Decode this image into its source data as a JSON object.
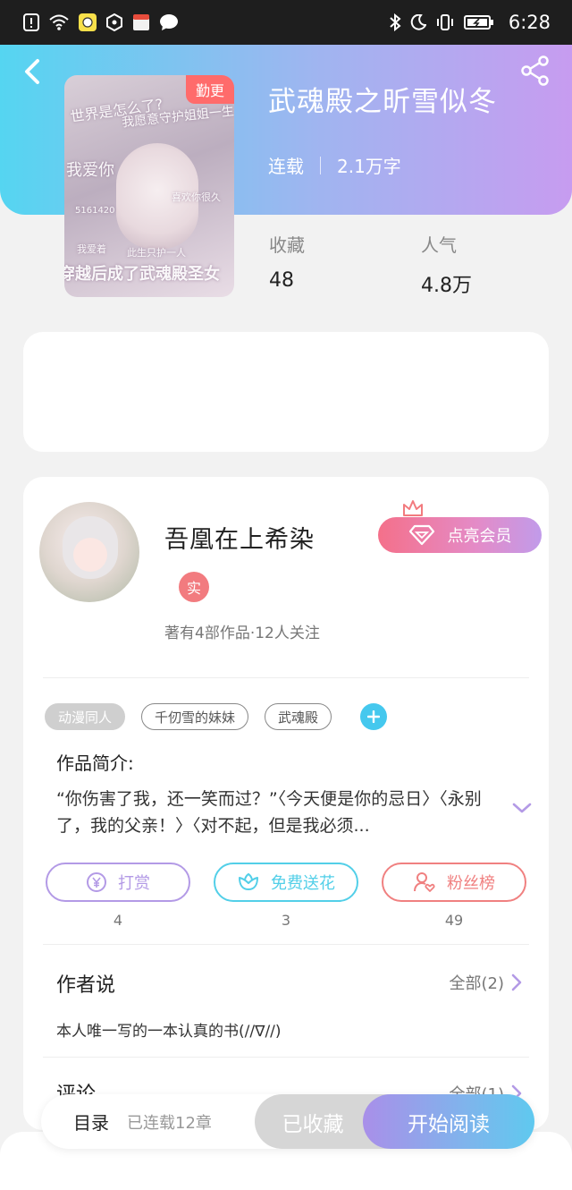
{
  "status_bar": {
    "time": "6:28"
  },
  "book": {
    "title": "武魂殿之昕雪似冬",
    "status": "连载",
    "word_count": "2.1万字",
    "cover_badge": "勤更",
    "cover_text": [
      "世界是怎么了?",
      "我愿意守护姐姐一生",
      "我爱你",
      "喜欢你很久",
      "5161420",
      "我爱着",
      "此生只护一人",
      "穿越后成了武魂殿圣女"
    ],
    "stats": {
      "favorites_label": "收藏",
      "favorites_value": "48",
      "popularity_label": "人气",
      "popularity_value": "4.8万"
    }
  },
  "author": {
    "name": "吾凰在上希染",
    "verified_badge": "实",
    "meta": "著有4部作品·12人关注",
    "vip_button": "点亮会员"
  },
  "tags": [
    "动漫同人",
    "千仞雪的妹妹",
    "武魂殿"
  ],
  "synopsis": {
    "heading": "作品简介:",
    "text": "“你伤害了我，还一笑而过？”〈今天便是你的忌日〉〈永别了，我的父亲！〉〈对不起，但是我必须..."
  },
  "actions": [
    {
      "label": "打赏",
      "count": "4",
      "color": "#b39ae6"
    },
    {
      "label": "免费送花",
      "count": "3",
      "color": "#52cfe8"
    },
    {
      "label": "粉丝榜",
      "count": "49",
      "color": "#f08080"
    }
  ],
  "author_says": {
    "heading": "作者说",
    "all_label": "全部(2)",
    "content": "本人唯一写的一本认真的书(//∇//)"
  },
  "comments": {
    "heading": "评论",
    "all_label": "全部(1)"
  },
  "bottom_bar": {
    "toc_label": "目录",
    "toc_status": "已连载12章",
    "collected_label": "已收藏",
    "read_label": "开始阅读"
  }
}
